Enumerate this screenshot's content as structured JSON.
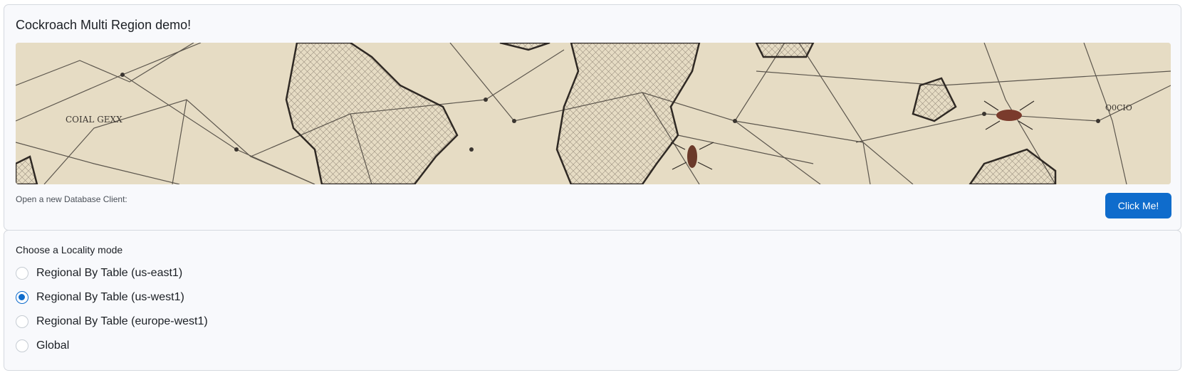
{
  "header": {
    "title": "Cockroach Multi Region demo!"
  },
  "banner": {
    "image": "world-map-sketch-illustration",
    "text_labels": [
      "COIAL GEXX",
      "Q0CIO"
    ]
  },
  "client": {
    "label": "Open a new Database Client:",
    "button_label": "Click Me!"
  },
  "locality": {
    "label": "Choose a Locality mode",
    "options": [
      {
        "label": "Regional By Table (us-east1)",
        "selected": false
      },
      {
        "label": "Regional By Table (us-west1)",
        "selected": true
      },
      {
        "label": "Regional By Table (europe-west1)",
        "selected": false
      },
      {
        "label": "Global",
        "selected": false
      }
    ]
  },
  "colors": {
    "accent": "#0f6ccc",
    "card_background": "#f8f9fc",
    "card_border": "#d5d9df",
    "map_paper": "#e8dfc8"
  }
}
